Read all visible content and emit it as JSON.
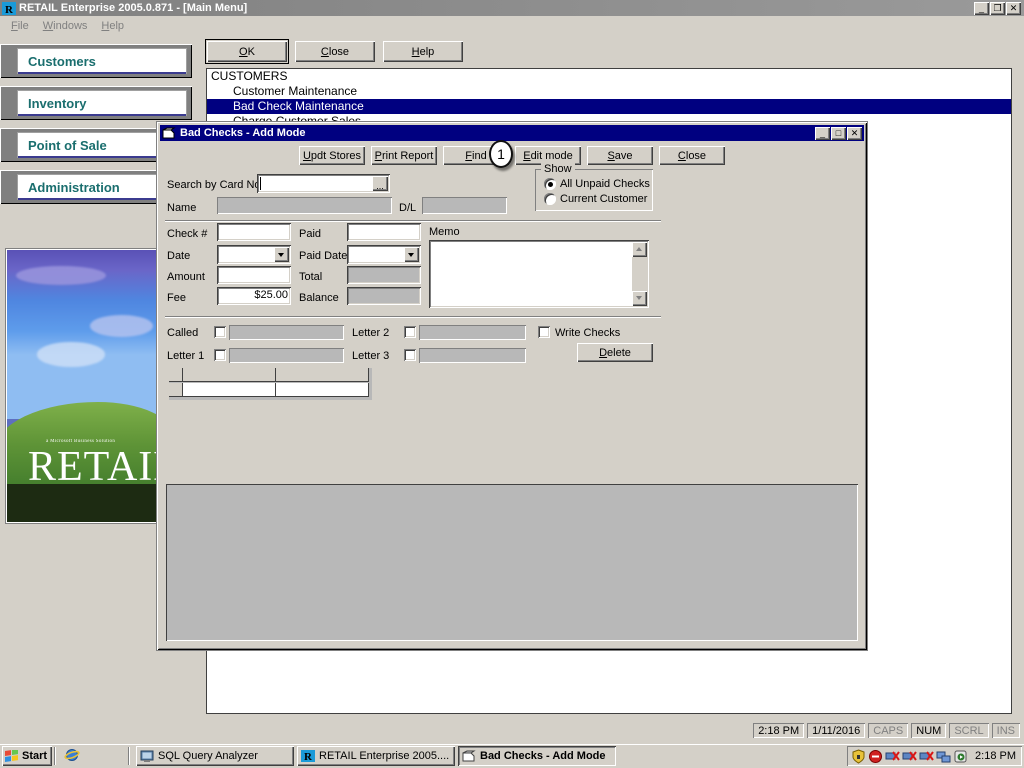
{
  "main_window": {
    "title": "RETAIL Enterprise 2005.0.871 - [Main Menu]",
    "icon": "retail-app-icon",
    "minimize_label": "_",
    "restore_label": "❐",
    "close_label": "✕",
    "menus": [
      {
        "label": "File",
        "accel": "F"
      },
      {
        "label": "Windows",
        "accel": "W"
      },
      {
        "label": "Help",
        "accel": "H"
      }
    ]
  },
  "sidebar": {
    "items": [
      {
        "label": "Customers"
      },
      {
        "label": "Inventory"
      },
      {
        "label": "Point of Sale"
      },
      {
        "label": "Administration"
      }
    ]
  },
  "splash": {
    "brand_small": "a Microsoft Business Solution",
    "brand_large": "RETAIL"
  },
  "main_toolbar": {
    "buttons": [
      {
        "label": "OK",
        "accel": "O",
        "default": true
      },
      {
        "label": "Close",
        "accel": "C",
        "default": false
      },
      {
        "label": "Help",
        "accel": "H",
        "default": false
      }
    ]
  },
  "menu_list": {
    "rows": [
      {
        "text": "CUSTOMERS",
        "indent": false,
        "selected": false
      },
      {
        "text": "Customer Maintenance",
        "indent": true,
        "selected": false
      },
      {
        "text": "Bad Check Maintenance",
        "indent": true,
        "selected": true
      },
      {
        "text": "Charge Customer Sales",
        "indent": true,
        "selected": false
      }
    ]
  },
  "dialog": {
    "title": "Bad Checks - Add Mode",
    "icon": "bad-checks-window-icon",
    "minimize_label": "_",
    "maximize_label": "□",
    "close_label": "✕",
    "toolbar": [
      {
        "label": "Updt Stores",
        "accel": "U"
      },
      {
        "label": "Print Report",
        "accel": "P"
      },
      {
        "label": "Find",
        "accel": "F"
      },
      {
        "label": "Edit mode",
        "accel": "E"
      },
      {
        "label": "Save",
        "accel": "S"
      },
      {
        "label": "Close",
        "accel": "C"
      }
    ],
    "search": {
      "label": "Search by Card No.",
      "value": "",
      "browse_label": "..."
    },
    "name": {
      "label": "Name",
      "value": ""
    },
    "dl": {
      "label": "D/L",
      "value": ""
    },
    "show_group": {
      "title": "Show",
      "options": [
        {
          "label": "All Unpaid Checks",
          "selected": true
        },
        {
          "label": "Current Customer",
          "selected": false
        }
      ]
    },
    "fields_left": [
      {
        "label": "Check #",
        "value": "",
        "type": "text",
        "readonly": false
      },
      {
        "label": "Date",
        "value": "",
        "type": "combo",
        "readonly": false
      },
      {
        "label": "Amount",
        "value": "",
        "type": "text",
        "readonly": false
      },
      {
        "label": "Fee",
        "value": "$25.00",
        "type": "text",
        "readonly": false
      }
    ],
    "fields_mid": [
      {
        "label": "Paid",
        "value": "",
        "type": "text",
        "readonly": false
      },
      {
        "label": "Paid Date",
        "value": "",
        "type": "combo",
        "readonly": false
      },
      {
        "label": "Total",
        "value": "",
        "type": "text",
        "readonly": true
      },
      {
        "label": "Balance",
        "value": "",
        "type": "text",
        "readonly": true
      }
    ],
    "memo": {
      "label": "Memo",
      "value": ""
    },
    "tracking_left": [
      {
        "label": "Called",
        "checked": false,
        "value": ""
      },
      {
        "label": "Letter 1",
        "checked": false,
        "value": ""
      }
    ],
    "tracking_mid": [
      {
        "label": "Letter 2",
        "checked": false,
        "value": ""
      },
      {
        "label": "Letter 3",
        "checked": false,
        "value": ""
      }
    ],
    "write_checks": {
      "label": "Write Checks",
      "checked": false
    },
    "delete_button": {
      "label": "Delete",
      "accel": "D"
    },
    "grid": {
      "headers": [
        "",
        "",
        ""
      ],
      "rows": [
        [
          "",
          "",
          ""
        ]
      ]
    }
  },
  "annotation": {
    "badge_number": "1"
  },
  "status_bar": {
    "cells": [
      {
        "text": "2:18 PM",
        "dim": false
      },
      {
        "text": "1/11/2016",
        "dim": false
      },
      {
        "text": "CAPS",
        "dim": true
      },
      {
        "text": "NUM",
        "dim": false
      },
      {
        "text": "SCRL",
        "dim": true
      },
      {
        "text": "INS",
        "dim": true
      }
    ]
  },
  "taskbar": {
    "start_label": "Start",
    "start_icon": "windows-flag-icon",
    "quick_launch": [
      {
        "icon": "internet-explorer-icon"
      }
    ],
    "tasks": [
      {
        "label": "SQL Query Analyzer",
        "icon": "sql-query-analyzer-icon",
        "active": false
      },
      {
        "label": "RETAIL Enterprise 2005....",
        "icon": "retail-app-icon",
        "active": false
      },
      {
        "label": "Bad Checks - Add Mode",
        "icon": "bad-checks-window-icon",
        "active": true
      }
    ],
    "tray": {
      "icons": [
        {
          "name": "security-shield-icon",
          "color": "#d8b21a"
        },
        {
          "name": "antivirus-icon",
          "color": "#c02020"
        },
        {
          "name": "network-disconnected-icon",
          "color": "#3050a0"
        },
        {
          "name": "network-disconnected-2-icon",
          "color": "#3050a0"
        },
        {
          "name": "network-disconnected-3-icon",
          "color": "#3050a0"
        },
        {
          "name": "network-activity-icon",
          "color": "#4070c0"
        },
        {
          "name": "media-player-icon",
          "color": "#3a7a3a"
        }
      ],
      "clock": "2:18 PM"
    }
  },
  "colors": {
    "face": "#d4d0c8",
    "dialog_title": "#000080",
    "selection": "#000080",
    "sidebar_text": "#1a6e6e",
    "readonly_field": "#b8b8b8"
  }
}
